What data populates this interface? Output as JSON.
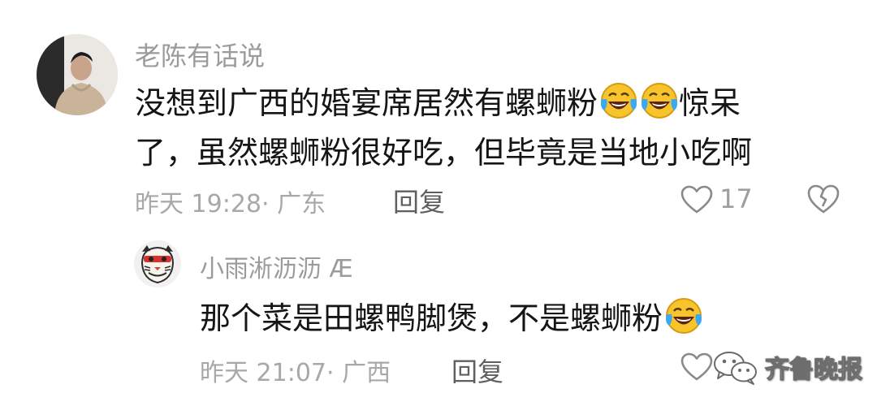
{
  "comment": {
    "username": "老陈有话说",
    "line1": "没想到广西的婚宴席居然有螺蛳粉",
    "line1_suffix": "惊呆",
    "line2": "了，虽然螺蛳粉很好吃，但毕竟是当地小吃啊",
    "meta": "昨天 19:28· 广东",
    "reply_label": "回复",
    "like_count": "17"
  },
  "reply": {
    "username": "小雨淅沥沥 Æ",
    "text": "那个菜是田螺鸭脚煲，不是螺蛳粉",
    "meta": "昨天 21:07· 广西",
    "reply_label": "回复"
  },
  "watermark": {
    "text": "齐鲁晚报"
  },
  "icons": {
    "emoji": "laughing-crying-emoji-icon",
    "like": "heart-outline-icon",
    "dislike": "broken-heart-icon",
    "watermark": "wechat-logo-icon"
  }
}
